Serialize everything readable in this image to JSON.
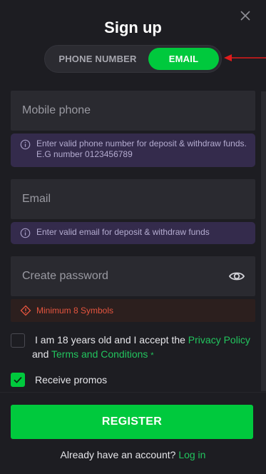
{
  "modal": {
    "title": "Sign up",
    "close_icon": "close-icon"
  },
  "tabs": [
    {
      "label": "PHONE NUMBER",
      "active": false
    },
    {
      "label": "EMAIL",
      "active": true
    }
  ],
  "fields": {
    "phone": {
      "placeholder": "Mobile phone",
      "value": "",
      "hint": "Enter valid phone number for deposit & withdraw funds. E.G number 0123456789"
    },
    "email": {
      "placeholder": "Email",
      "value": "",
      "hint": "Enter valid email for deposit & withdraw funds"
    },
    "password": {
      "placeholder": "Create password",
      "value": "",
      "error": "Minimum 8 Symbols",
      "toggle_icon": "eye-icon"
    }
  },
  "terms": {
    "checked": false,
    "text_before": "I am 18 years old and I accept the ",
    "privacy_link": "Privacy Policy",
    "and": " and ",
    "terms_link": "Terms and Conditions",
    "required_mark": "*"
  },
  "promos": {
    "checked": true,
    "label": "Receive promos"
  },
  "register_button": "REGISTER",
  "login": {
    "prompt": "Already have an account?",
    "link": "Log in"
  },
  "colors": {
    "background": "#1d1d22",
    "field": "#2a2a30",
    "accent_green": "#00c93d",
    "link_green": "#22c55e",
    "hint_bg": "#342b4c",
    "error_bg": "#2c1f1e",
    "error_text": "#e5553f",
    "annotation_red": "#e01b1b"
  }
}
